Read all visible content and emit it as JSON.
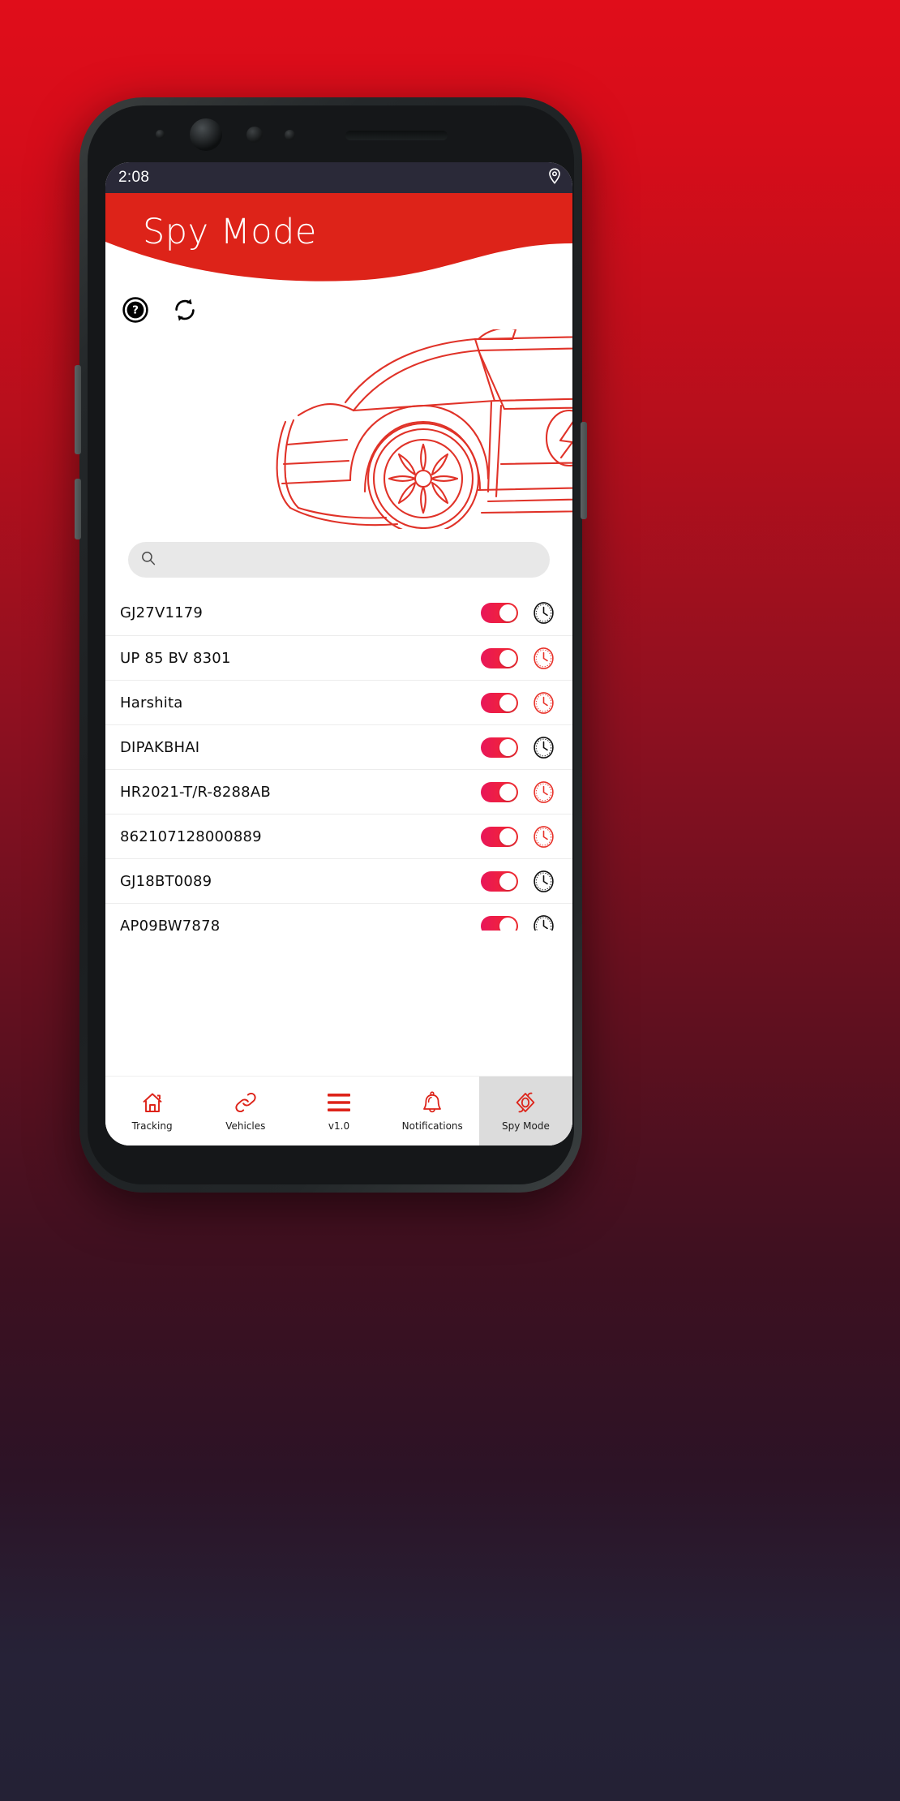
{
  "theme": {
    "brand_red": "#dd2319",
    "accent_pink": "#e8165a",
    "status_bar_bg": "#2a2938",
    "active_nav_bg": "#dcdcdc"
  },
  "status_bar": {
    "time": "2:08",
    "icons": [
      "location-pin-icon"
    ]
  },
  "header": {
    "title": "Spy Mode"
  },
  "actions": [
    {
      "name": "help-icon",
      "label": "Help"
    },
    {
      "name": "refresh-icon",
      "label": "Refresh"
    }
  ],
  "illustration": {
    "name": "car-line-art",
    "badge": "lightning-bolt"
  },
  "search": {
    "value": "",
    "placeholder": "",
    "icon": "search-icon"
  },
  "vehicles": [
    {
      "name": "GJ27V1179",
      "enabled": true,
      "clock_color": "#111111"
    },
    {
      "name": "UP 85 BV 8301",
      "enabled": true,
      "clock_color": "#e8342c"
    },
    {
      "name": "Harshita",
      "enabled": true,
      "clock_color": "#e8342c"
    },
    {
      "name": "DIPAKBHAI",
      "enabled": true,
      "clock_color": "#111111"
    },
    {
      "name": "HR2021-T/R-8288AB",
      "enabled": true,
      "clock_color": "#e8342c"
    },
    {
      "name": "862107128000889",
      "enabled": true,
      "clock_color": "#e8342c"
    },
    {
      "name": "GJ18BT0089",
      "enabled": true,
      "clock_color": "#111111"
    },
    {
      "name": "AP09BW7878",
      "enabled": true,
      "clock_color": "#111111"
    }
  ],
  "bottom_nav": {
    "items": [
      {
        "label": "Tracking",
        "icon": "home-icon",
        "active": false
      },
      {
        "label": "Vehicles",
        "icon": "link-icon",
        "active": false
      },
      {
        "label": "v1.0",
        "icon": "hamburger-menu-icon",
        "active": false
      },
      {
        "label": "Notifications",
        "icon": "bell-icon",
        "active": false
      },
      {
        "label": "Spy Mode",
        "icon": "eye-icon",
        "active": true
      }
    ]
  }
}
